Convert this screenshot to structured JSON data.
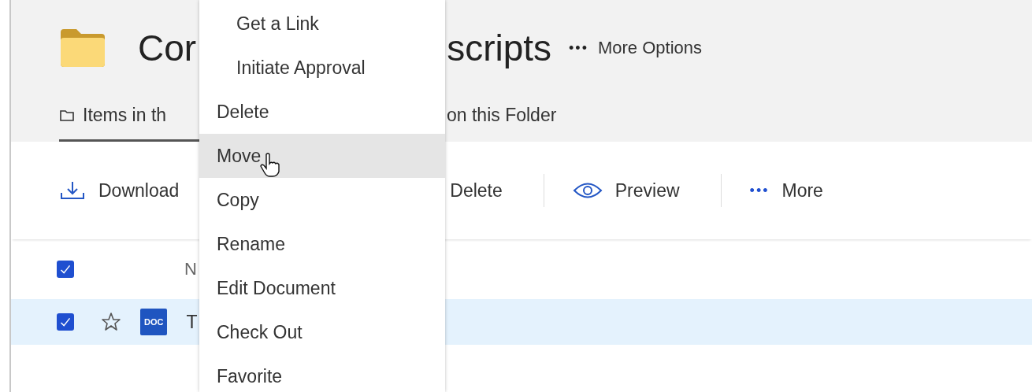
{
  "header": {
    "title_start": "Cor",
    "title_end": "scripts",
    "more_options": {
      "icon": "•••",
      "label": "More Options"
    }
  },
  "tabs": [
    {
      "label": "Items in th",
      "selected": true
    },
    {
      "label": "on this Folder",
      "selected": false
    }
  ],
  "toolbar": [
    {
      "kind": "download",
      "label": "Download"
    },
    {
      "kind": "delete",
      "label": "Delete"
    },
    {
      "kind": "preview",
      "label": "Preview"
    },
    {
      "kind": "more",
      "icon": "•••",
      "label": "More"
    }
  ],
  "table": {
    "header": {
      "checked": true,
      "column_2": "N"
    },
    "rows": [
      {
        "checked": true,
        "favorite": false,
        "type": "DOC",
        "name": "T",
        "selected": true
      }
    ]
  },
  "context_menu": [
    {
      "label": "Get a Link",
      "indented": true,
      "selected": false
    },
    {
      "label": "Initiate Approval",
      "indented": true,
      "selected": false
    },
    {
      "label": "Delete",
      "indented": false,
      "selected": false
    },
    {
      "label": "Move",
      "indented": false,
      "selected": true
    },
    {
      "label": "Copy",
      "indented": false,
      "selected": false
    },
    {
      "label": "Rename",
      "indented": false,
      "selected": false
    },
    {
      "label": "Edit Document",
      "indented": false,
      "selected": false
    },
    {
      "label": "Check Out",
      "indented": false,
      "selected": false
    },
    {
      "label": "Favorite",
      "indented": false,
      "selected": false
    }
  ]
}
